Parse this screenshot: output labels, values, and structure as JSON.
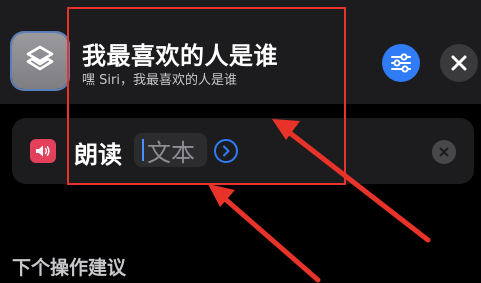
{
  "shortcut": {
    "title": "我最喜欢的人是谁",
    "subtitle": "嘿 Siri，我最喜欢的人是谁"
  },
  "action": {
    "label": "朗读",
    "variable_label": "文本"
  },
  "suggestions": {
    "title": "下个操作建议"
  },
  "icons": {
    "app": "shortcuts-icon",
    "settings": "sliders-icon",
    "close": "close-icon",
    "speaker": "speaker-icon",
    "expand": "chevron-right-icon",
    "clear": "clear-icon"
  },
  "colors": {
    "accent": "#2f7cf6",
    "speak_action": "#e2405b",
    "annotation": "#e8332a",
    "background": "#000000",
    "surface": "#1c1c1e"
  }
}
